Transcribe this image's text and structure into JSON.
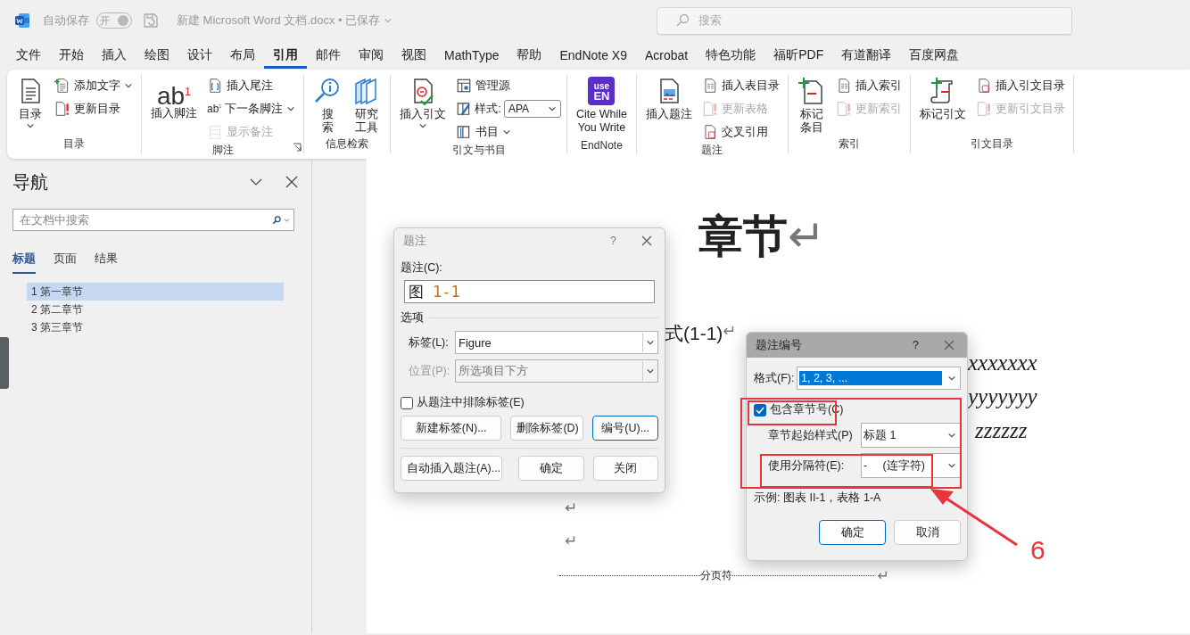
{
  "title_bar": {
    "autosave_label": "自动保存",
    "autosave_toggle": {
      "label": "开",
      "on": true
    },
    "document_title": "新建 Microsoft Word 文档.docx • 已保存",
    "search": {
      "placeholder": "搜索"
    }
  },
  "menu_tabs": [
    {
      "label": "文件",
      "selected": false
    },
    {
      "label": "开始",
      "selected": false
    },
    {
      "label": "插入",
      "selected": false
    },
    {
      "label": "绘图",
      "selected": false
    },
    {
      "label": "设计",
      "selected": false
    },
    {
      "label": "布局",
      "selected": false
    },
    {
      "label": "引用",
      "selected": true
    },
    {
      "label": "邮件",
      "selected": false
    },
    {
      "label": "审阅",
      "selected": false
    },
    {
      "label": "视图",
      "selected": false
    },
    {
      "label": "MathType",
      "selected": false
    },
    {
      "label": "帮助",
      "selected": false
    },
    {
      "label": "EndNote X9",
      "selected": false
    },
    {
      "label": "Acrobat",
      "selected": false
    },
    {
      "label": "特色功能",
      "selected": false
    },
    {
      "label": "福昕PDF",
      "selected": false
    },
    {
      "label": "有道翻译",
      "selected": false
    },
    {
      "label": "百度网盘",
      "selected": false
    }
  ],
  "ribbon": {
    "groups": [
      {
        "label": "目录",
        "launcher": false,
        "items": [
          {
            "kind": "large",
            "label": "目录",
            "dropdown": true,
            "disabled": false
          },
          {
            "kind": "small",
            "label": "添加文字",
            "dropdown": true,
            "disabled": false
          },
          {
            "kind": "small",
            "label": "更新目录",
            "dropdown": false,
            "disabled": false
          }
        ]
      },
      {
        "label": "脚注",
        "launcher": true,
        "items": [
          {
            "kind": "large",
            "label": "插入脚注",
            "glyph": "ab$^{1}$",
            "dropdown": false,
            "disabled": false
          },
          {
            "kind": "small",
            "label": "插入尾注",
            "dropdown": false,
            "disabled": false
          },
          {
            "kind": "small",
            "label": "下一条脚注",
            "glyph": "ab$^{1}$",
            "dropdown": true,
            "disabled": false
          },
          {
            "kind": "small",
            "label": "显示备注",
            "dropdown": false,
            "disabled": true
          }
        ]
      },
      {
        "label": "信息检索",
        "launcher": false,
        "items": [
          {
            "kind": "stacked",
            "label": "搜索",
            "dropdown": false,
            "disabled": false
          },
          {
            "kind": "stacked",
            "label": "研究工具",
            "dropdown": false,
            "disabled": false
          }
        ]
      },
      {
        "label": "引文与书目",
        "launcher": false,
        "items": [
          {
            "kind": "large",
            "label": "插入引文",
            "dropdown": true,
            "disabled": false
          },
          {
            "kind": "small",
            "label": "管理源",
            "dropdown": false,
            "disabled": false
          },
          {
            "kind": "select",
            "label": "样式:",
            "value": "APA",
            "dropdown": true,
            "disabled": false
          },
          {
            "kind": "small",
            "label": "书目",
            "dropdown": true,
            "disabled": false
          }
        ]
      },
      {
        "label": "EndNote",
        "launcher": false,
        "items": [
          {
            "kind": "large",
            "label": "Cite While\nYou Write",
            "logo_lines": [
              "use",
              "EN"
            ],
            "dropdown": false,
            "disabled": false
          }
        ]
      },
      {
        "label": "题注",
        "launcher": false,
        "items": [
          {
            "kind": "large",
            "label": "插入题注",
            "dropdown": false,
            "disabled": false
          },
          {
            "kind": "small",
            "label": "插入表目录",
            "dropdown": false,
            "disabled": false
          },
          {
            "kind": "small",
            "label": "更新表格",
            "dropdown": false,
            "disabled": true
          },
          {
            "kind": "small",
            "label": "交叉引用",
            "dropdown": false,
            "disabled": false
          }
        ]
      },
      {
        "label": "索引",
        "launcher": false,
        "items": [
          {
            "kind": "stacked",
            "label": "标记条目",
            "dropdown": false,
            "disabled": false
          },
          {
            "kind": "small",
            "label": "插入索引",
            "dropdown": false,
            "disabled": false
          },
          {
            "kind": "small",
            "label": "更新索引",
            "dropdown": false,
            "disabled": true
          }
        ]
      },
      {
        "label": "引文目录",
        "launcher": false,
        "items": [
          {
            "kind": "large",
            "label": "标记引文",
            "dropdown": false,
            "disabled": false
          },
          {
            "kind": "small",
            "label": "插入引文目录",
            "dropdown": false,
            "disabled": false
          },
          {
            "kind": "small",
            "label": "更新引文目录",
            "dropdown": false,
            "disabled": true
          }
        ]
      }
    ]
  },
  "navigation": {
    "title": "导航",
    "search": {
      "placeholder": "在文档中搜索"
    },
    "tabs": [
      {
        "label": "标题",
        "selected": true
      },
      {
        "label": "页面",
        "selected": false
      },
      {
        "label": "结果",
        "selected": false
      }
    ],
    "headings": [
      {
        "label": "1 第一章节",
        "selected": true
      },
      {
        "label": "2 第二章节",
        "selected": false
      },
      {
        "label": "3 第三章节",
        "selected": false
      }
    ]
  },
  "document": {
    "heading": "章节",
    "heading_mark": "↵",
    "equation_line": "式(1-1)",
    "equation_mark": "↵",
    "variable_lines": [
      "xxxxxxx",
      "yyyyyyy",
      "zzzzzz"
    ],
    "paragraph_marks": [
      "↵",
      "↵"
    ],
    "page_break": {
      "label": "分页符",
      "mark": "↵"
    }
  },
  "caption_dialog": {
    "title": "题注",
    "help": "?",
    "caption_label": "题注(C):",
    "caption_value": {
      "label": "图",
      "number": "1-1"
    },
    "options_heading": "选项",
    "fields": [
      {
        "label": "标签(L):",
        "value": "Figure",
        "disabled": false
      },
      {
        "label": "位置(P):",
        "value": "所选项目下方",
        "disabled": true
      }
    ],
    "exclude_label": {
      "label": "从题注中排除标签(E)",
      "checked": false
    },
    "buttons": [
      {
        "label": "新建标签(N)...",
        "focused": false
      },
      {
        "label": "删除标签(D)",
        "focused": false
      },
      {
        "label": "编号(U)...",
        "focused": true
      }
    ],
    "footer_buttons": [
      {
        "label": "自动插入题注(A)...",
        "focused": false
      },
      {
        "label": "确定",
        "focused": false
      },
      {
        "label": "关闭",
        "focused": false
      }
    ]
  },
  "numbering_dialog": {
    "title": "题注编号",
    "help": "?",
    "format": {
      "label": "格式(F):",
      "value": "1, 2, 3, ..."
    },
    "include_chapter": {
      "label": "包含章节号(C)",
      "checked": true
    },
    "fields": [
      {
        "label": "章节起始样式(P)",
        "value": "标题 1"
      },
      {
        "label": "使用分隔符(E):",
        "value": "-     (连字符)"
      }
    ],
    "example": "示例:  图表 II-1，表格 1-A",
    "buttons": [
      {
        "label": "确定",
        "focused": true
      },
      {
        "label": "取消",
        "focused": false
      }
    ]
  },
  "annotation": {
    "number": "6"
  }
}
